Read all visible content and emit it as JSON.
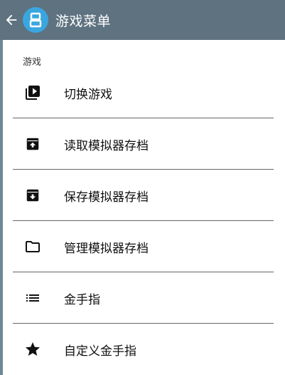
{
  "appbar": {
    "title": "游戏菜单",
    "back_icon": "arrow-back-icon",
    "app_icon": "app-logo-icon",
    "color": "#5e7280",
    "app_icon_color": "#3aa6df"
  },
  "section": {
    "header": "游戏"
  },
  "menu": {
    "items": [
      {
        "label": "切换游戏",
        "icon": "video-library-icon"
      },
      {
        "label": "读取模拟器存档",
        "icon": "archive-upload-icon"
      },
      {
        "label": "保存模拟器存档",
        "icon": "archive-download-icon"
      },
      {
        "label": "管理模拟器存档",
        "icon": "folder-icon"
      },
      {
        "label": "金手指",
        "icon": "list-icon"
      },
      {
        "label": "自定义金手指",
        "icon": "star-icon"
      }
    ]
  }
}
